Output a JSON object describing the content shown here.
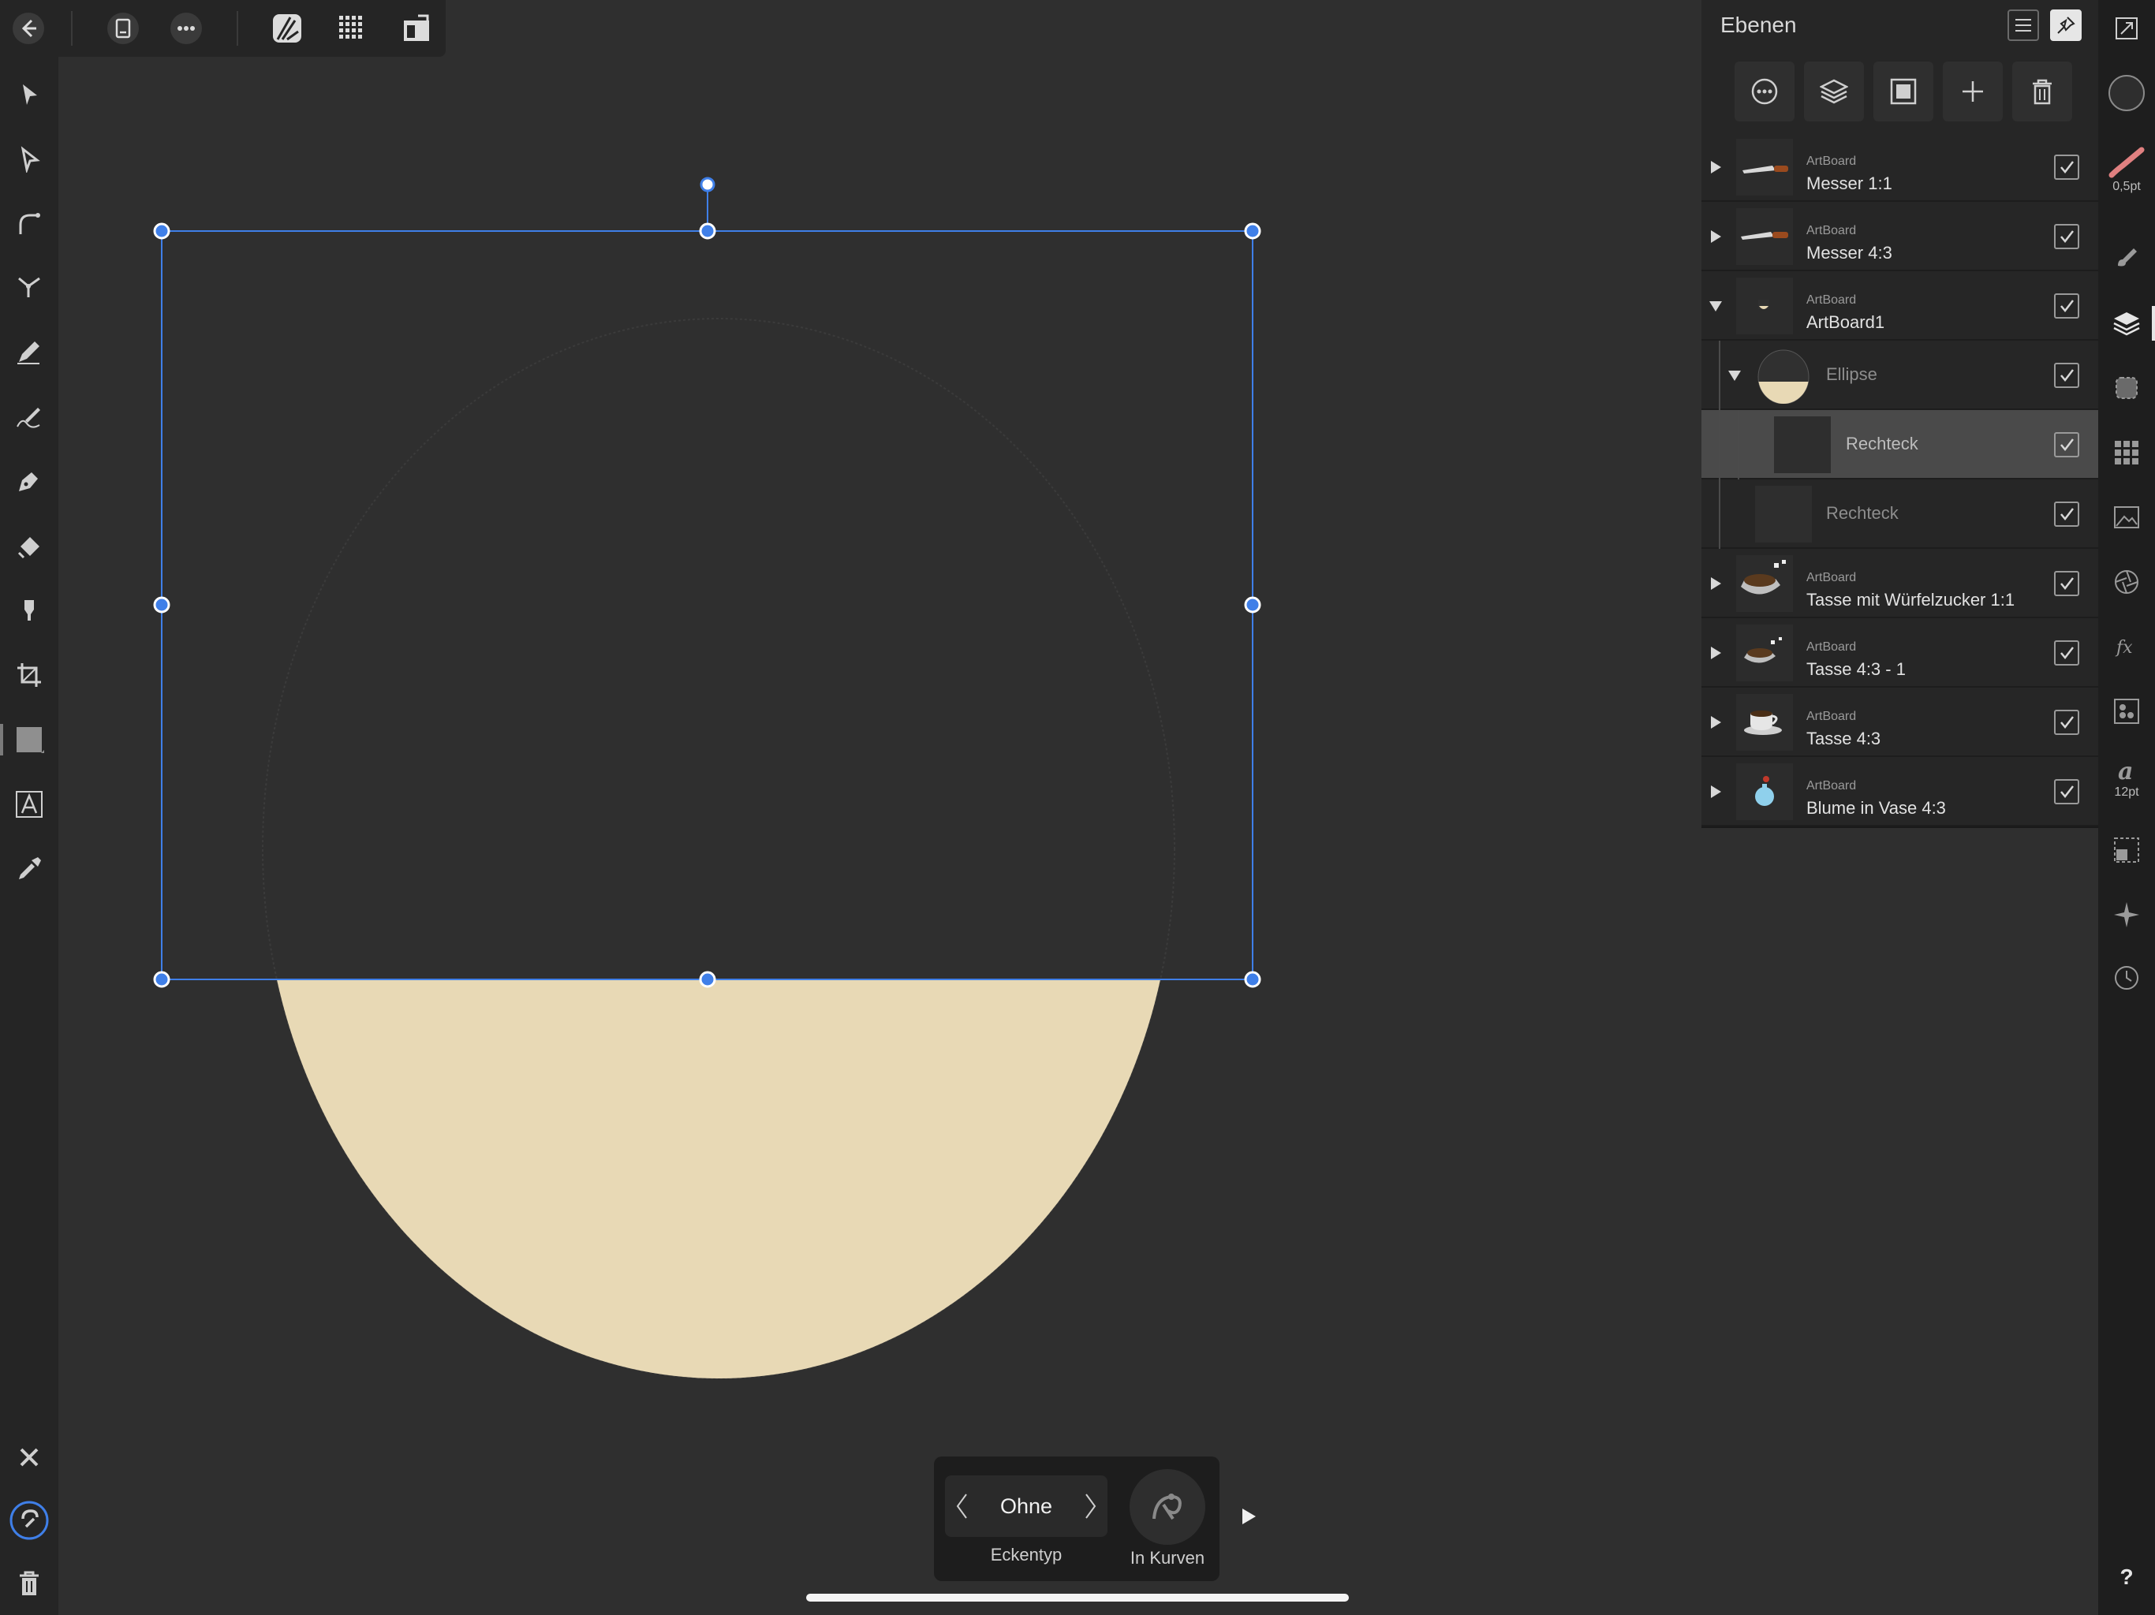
{
  "app": {
    "top_toolbar": {
      "back": "back-icon",
      "document": "document-icon",
      "more": "more-icon",
      "persona": "designer-persona-icon",
      "grid": "grid-icon",
      "export": "export-icon"
    },
    "left_tools": [
      "move-tool",
      "node-tool",
      "corner-tool",
      "point-transform-tool",
      "pencil-tool",
      "vector-brush-tool",
      "pen-tool",
      "fill-tool",
      "transparency-tool",
      "crop-tool",
      "rectangle-tool",
      "artistic-text-tool",
      "color-picker-tool"
    ],
    "left_bottom": [
      "close-icon",
      "snapping-icon",
      "trash-icon"
    ],
    "right_strip": {
      "stroke_width": "0,5pt",
      "font_size": "12pt",
      "help": "?"
    }
  },
  "layers_panel": {
    "title": "Ebenen",
    "rows": [
      {
        "kind": "ArtBoard",
        "name": "Messer 1:1",
        "arrow": "right",
        "thumb": "knife",
        "checked": true
      },
      {
        "kind": "ArtBoard",
        "name": "Messer 4:3",
        "arrow": "right",
        "thumb": "knife",
        "checked": true
      },
      {
        "kind": "ArtBoard",
        "name": "ArtBoard1",
        "arrow": "down",
        "thumb": "small-ellipse",
        "checked": true
      },
      {
        "kind": "",
        "name": "Ellipse",
        "arrow": "down",
        "thumb": "ellipse",
        "checked": true
      },
      {
        "kind": "",
        "name": "Rechteck",
        "arrow": "",
        "thumb": "rect",
        "checked": true,
        "selected": true
      },
      {
        "kind": "",
        "name": "Rechteck",
        "arrow": "",
        "thumb": "rect",
        "checked": true
      },
      {
        "kind": "ArtBoard",
        "name": "Tasse mit Würfelzucker 1:1",
        "arrow": "right",
        "thumb": "cup",
        "checked": true
      },
      {
        "kind": "ArtBoard",
        "name": "Tasse 4:3 - 1",
        "arrow": "right",
        "thumb": "cup",
        "checked": true
      },
      {
        "kind": "ArtBoard",
        "name": "Tasse 4:3",
        "arrow": "right",
        "thumb": "cup2",
        "checked": true
      },
      {
        "kind": "ArtBoard",
        "name": "Blume in Vase 4:3",
        "arrow": "right",
        "thumb": "vase",
        "checked": true
      }
    ]
  },
  "context_bar": {
    "corner_type_value": "Ohne",
    "corner_type_label": "Eckentyp",
    "convert_label": "In Kurven"
  },
  "colors": {
    "canvas_bg": "#2f2f2f",
    "ellipse_fill": "#e8d9b5",
    "selection": "#3f7fe8",
    "panel_bg": "#262626"
  }
}
